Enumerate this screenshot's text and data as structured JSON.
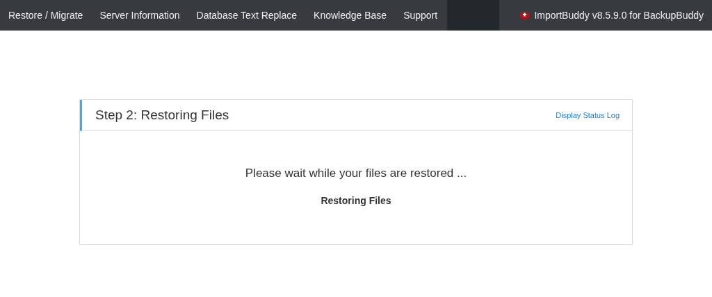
{
  "nav": {
    "items": [
      {
        "label": "Restore / Migrate"
      },
      {
        "label": "Server Information"
      },
      {
        "label": "Database Text Replace"
      },
      {
        "label": "Knowledge Base"
      },
      {
        "label": "Support"
      }
    ],
    "product": "ImportBuddy v8.5.9.0 for BackupBuddy"
  },
  "panel": {
    "title": "Step 2: Restoring Files",
    "link": "Display Status Log",
    "message": "Please wait while your files are restored ...",
    "status": "Restoring Files"
  }
}
